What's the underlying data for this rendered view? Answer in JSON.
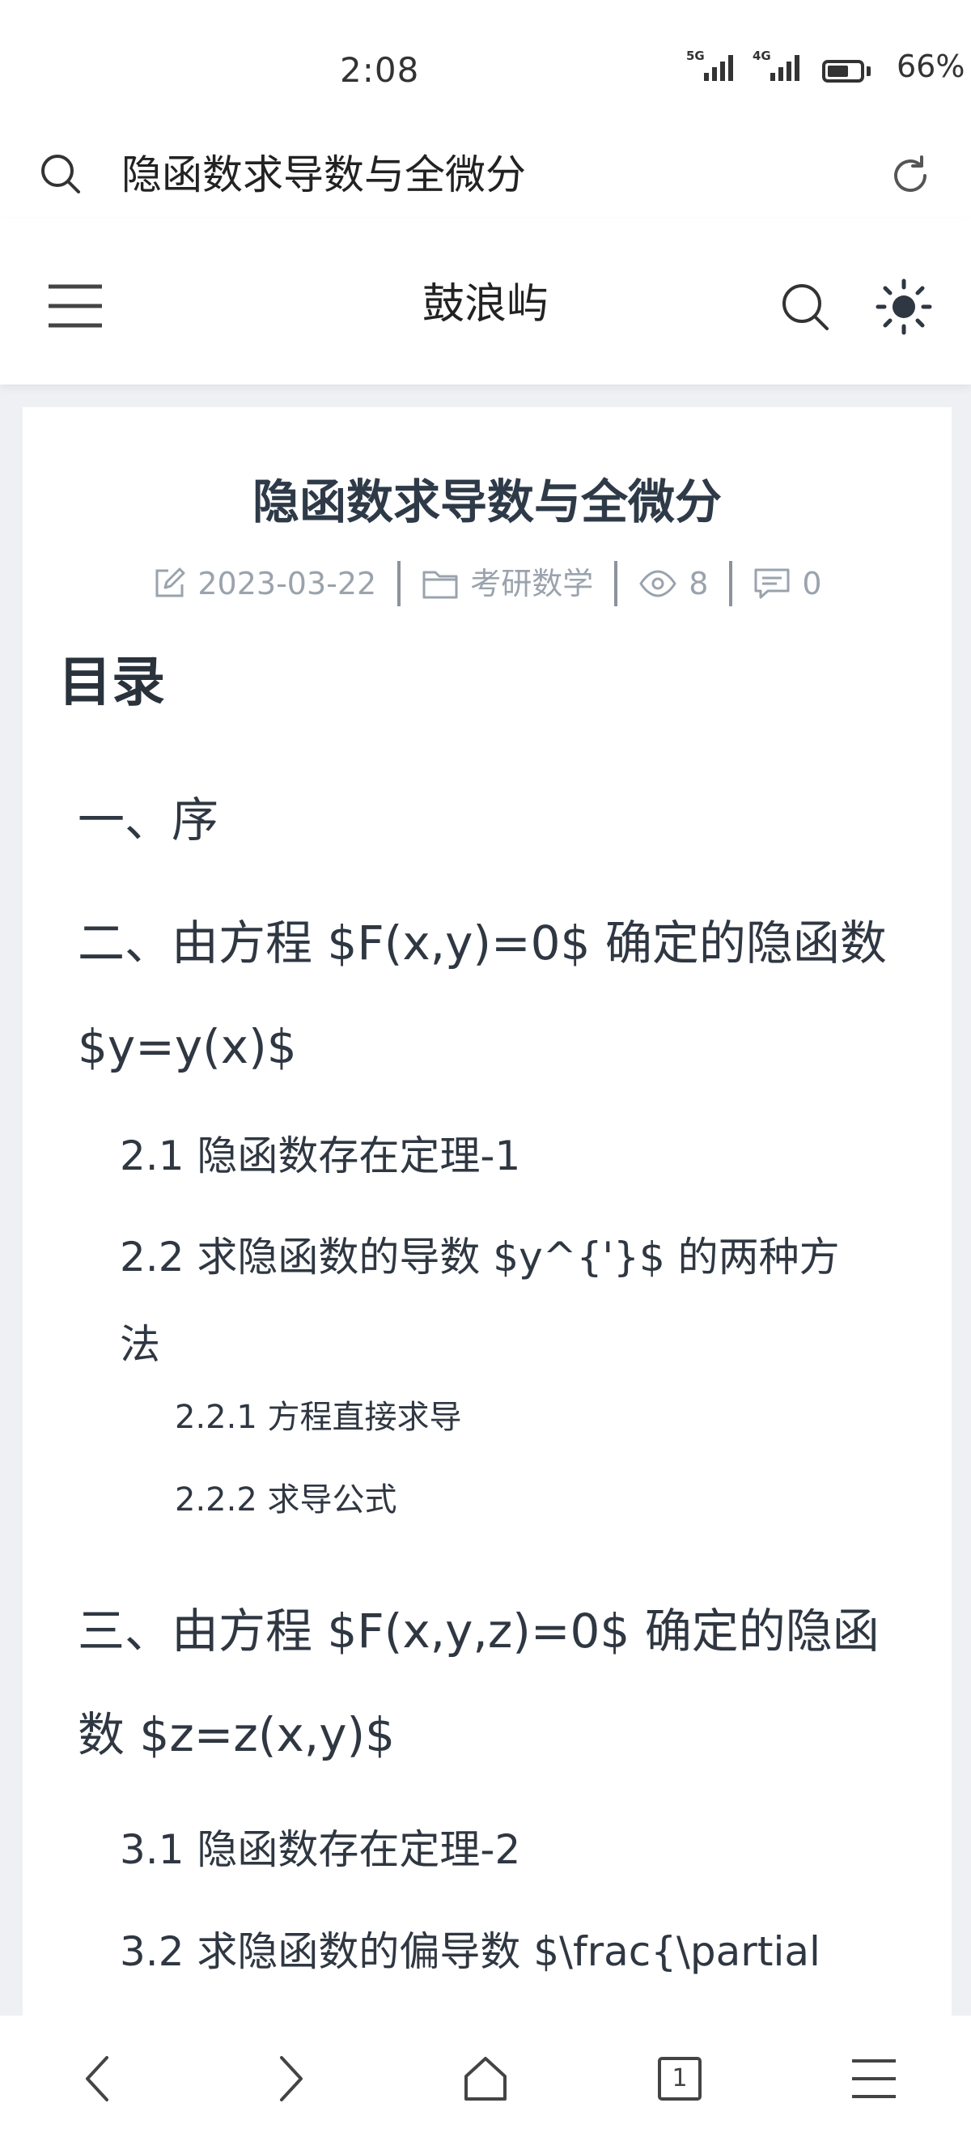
{
  "status_bar": {
    "time": "2:08",
    "network_1": "5G",
    "network_2": "4G",
    "battery_percent": 66,
    "battery_label": "66%"
  },
  "browser": {
    "address_text": "隐函数求导数与全微分",
    "tab_count": "1"
  },
  "site": {
    "title": "鼓浪屿"
  },
  "post": {
    "title": "隐函数求导数与全微分",
    "date": "2023-03-22",
    "category": "考研数学",
    "views": "8",
    "comments": "0"
  },
  "toc": {
    "heading": "目录",
    "items": [
      {
        "level": 1,
        "text": "一、序"
      },
      {
        "level": 1,
        "text": "二、由方程 $F(x,y)=0$ 确定的隐函数 $y=y(x)$"
      },
      {
        "level": 2,
        "text": "2.1 隐函数存在定理-1"
      },
      {
        "level": 2,
        "text": "2.2 求隐函数的导数 $y^{'}$ 的两种方法"
      },
      {
        "level": 3,
        "text": "2.2.1 方程直接求导"
      },
      {
        "level": 3,
        "text": "2.2.2 求导公式"
      },
      {
        "level": 1,
        "text": "三、由方程 $F(x,y,z)=0$ 确定的隐函数 $z=z(x,y)$"
      },
      {
        "level": 2,
        "text": "3.1 隐函数存在定理-2"
      },
      {
        "level": 2,
        "text": "3.2 求隐函数的偏导数 $\\frac{\\partial"
      }
    ]
  },
  "icons": {
    "address_bar": [
      "search-icon",
      "reload-icon"
    ],
    "header": [
      "menu-icon",
      "search-icon",
      "sun-icon"
    ],
    "meta": [
      "edit-icon",
      "folder-icon",
      "eye-icon",
      "comment-icon"
    ],
    "bottom_nav": [
      "back-icon",
      "forward-icon",
      "home-icon",
      "tabs-icon",
      "menu-icon"
    ]
  },
  "colors": {
    "background": "#eef0f3",
    "card": "#ffffff",
    "text": "#2f3742",
    "meta": "#9aa3ad"
  }
}
